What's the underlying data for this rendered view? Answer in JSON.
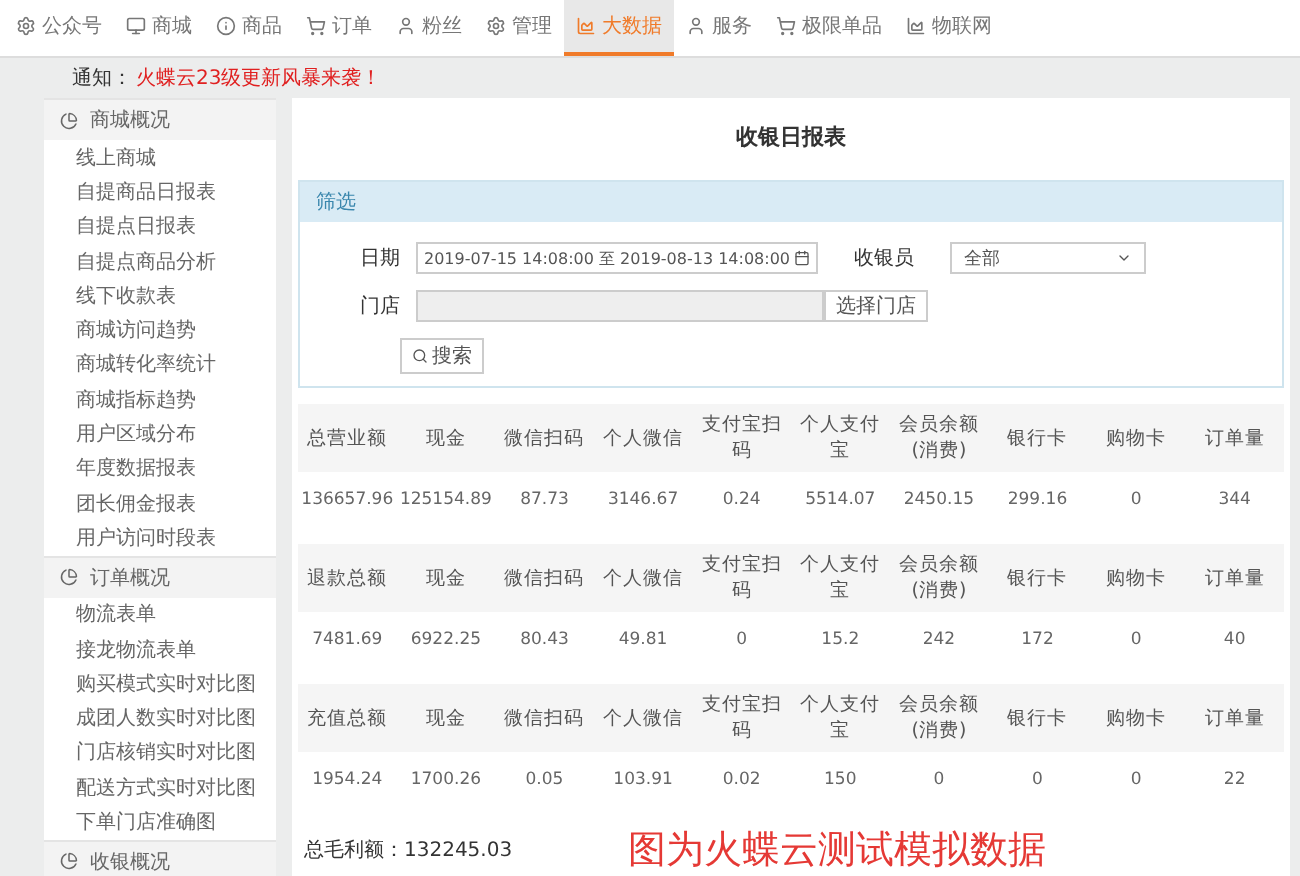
{
  "nav": [
    {
      "label": "公众号",
      "selected": false
    },
    {
      "label": "商城",
      "selected": false
    },
    {
      "label": "商品",
      "selected": false
    },
    {
      "label": "订单",
      "selected": false
    },
    {
      "label": "粉丝",
      "selected": false
    },
    {
      "label": "管理",
      "selected": false
    },
    {
      "label": "大数据",
      "selected": true
    },
    {
      "label": "服务",
      "selected": false
    },
    {
      "label": "极限单品",
      "selected": false
    },
    {
      "label": "物联网",
      "selected": false
    }
  ],
  "notice": {
    "label": "通知：",
    "text": "火蝶云23级更新风暴来袭！"
  },
  "sidebar": [
    {
      "title": "商城概况",
      "items": [
        "线上商城",
        "自提商品日报表",
        "自提点日报表",
        "自提点商品分析",
        "线下收款表",
        "商城访问趋势",
        "商城转化率统计",
        "商城指标趋势",
        "用户区域分布",
        "年度数据报表",
        "团长佣金报表",
        "用户访问时段表"
      ]
    },
    {
      "title": "订单概况",
      "items": [
        "物流表单",
        "接龙物流表单",
        "购买模式实时对比图",
        "成团人数实时对比图",
        "门店核销实时对比图",
        "配送方式实时对比图",
        "下单门店准确图"
      ]
    },
    {
      "title": "收银概况"
    }
  ],
  "page_title": "收银日报表",
  "filter": {
    "title": "筛选",
    "date_label": "日期",
    "date_value": "2019-07-15 14:08:00 至 2019-08-13 14:08:00",
    "cashier_label": "收银员",
    "cashier_value": "全部",
    "store_label": "门店",
    "store_button": "选择门店",
    "search_button": "搜索"
  },
  "tables": [
    {
      "columns": [
        "总营业额",
        "现金",
        "微信扫码",
        "个人微信",
        "支付宝扫码",
        "个人支付宝",
        "会员余额 (消费)",
        "银行卡",
        "购物卡",
        "订单量"
      ],
      "values": [
        "136657.96",
        "125154.89",
        "87.73",
        "3146.67",
        "0.24",
        "5514.07",
        "2450.15",
        "299.16",
        "0",
        "344"
      ]
    },
    {
      "columns": [
        "退款总额",
        "现金",
        "微信扫码",
        "个人微信",
        "支付宝扫码",
        "个人支付宝",
        "会员余额 (消费)",
        "银行卡",
        "购物卡",
        "订单量"
      ],
      "values": [
        "7481.69",
        "6922.25",
        "80.43",
        "49.81",
        "0",
        "15.2",
        "242",
        "172",
        "0",
        "40"
      ]
    },
    {
      "columns": [
        "充值总额",
        "现金",
        "微信扫码",
        "个人微信",
        "支付宝扫码",
        "个人支付宝",
        "会员余额 (消费)",
        "银行卡",
        "购物卡",
        "订单量"
      ],
      "values": [
        "1954.24",
        "1700.26",
        "0.05",
        "103.91",
        "0.02",
        "150",
        "0",
        "0",
        "0",
        "22"
      ]
    }
  ],
  "gross_profit": "总毛利额：132245.03",
  "overlay_note": "图为火蝶云测试模拟数据"
}
